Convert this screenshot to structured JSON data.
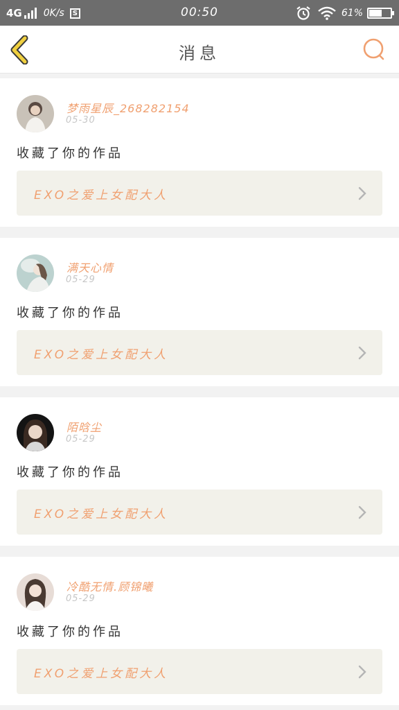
{
  "status_bar": {
    "network": "4G",
    "speed": "0K/s",
    "s_icon": "S",
    "time": "00:50",
    "battery": "61%",
    "battery_level": 0.61
  },
  "header": {
    "title": "消息",
    "back_icon": "chevron-left-icon",
    "search_icon": "search-icon"
  },
  "colors": {
    "accent": "#f0a070",
    "back_icon": "#f0d040",
    "card_link_bg": "#f2f1ea"
  },
  "messages": [
    {
      "username": "梦雨星辰_268282154",
      "date": "05-30",
      "action": "收藏了你的作品",
      "work_title": "EXO之爱上女配大人"
    },
    {
      "username": "满天心情",
      "date": "05-29",
      "action": "收藏了你的作品",
      "work_title": "EXO之爱上女配大人"
    },
    {
      "username": "陌晗尘",
      "date": "05-29",
      "action": "收藏了你的作品",
      "work_title": "EXO之爱上女配大人"
    },
    {
      "username": "冷酷无情.顾锦曦",
      "date": "05-29",
      "action": "收藏了你的作品",
      "work_title": "EXO之爱上女配大人"
    }
  ]
}
